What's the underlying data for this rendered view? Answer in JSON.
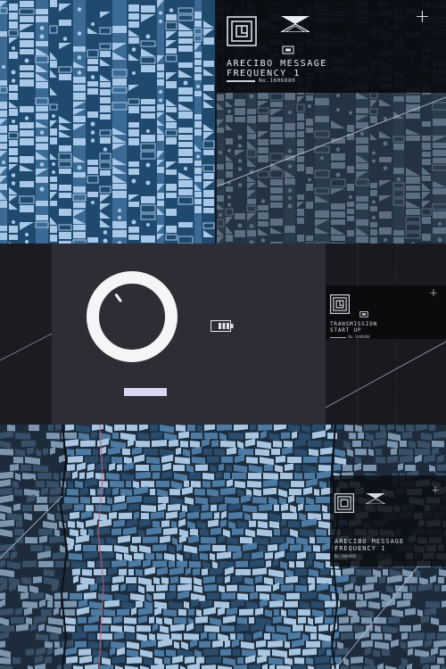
{
  "message": {
    "title_line1": "ARECIBO MESSAGE",
    "title_line2": "FREQUENCY 1",
    "serial": "No.1606880"
  },
  "transmission": {
    "title_line1": "TRANSMISSION",
    "title_line2": "START UP",
    "serial": "No.1606880"
  },
  "dial": {
    "level": 0.38
  },
  "colors": {
    "pattern_light": "#a9c8e8",
    "pattern_mid": "#3b6b94",
    "pattern_dark": "#1f4a6e",
    "dial_ring": "#f5f5f7",
    "dial_button": "#dcd6f2",
    "card_bg": "#0b0b0e"
  },
  "icons": {
    "logo": "concentric-square-logo-icon",
    "mark": "crosshatch-triangle-mark-icon",
    "plus": "plus-icon",
    "battery": "battery-icon"
  }
}
